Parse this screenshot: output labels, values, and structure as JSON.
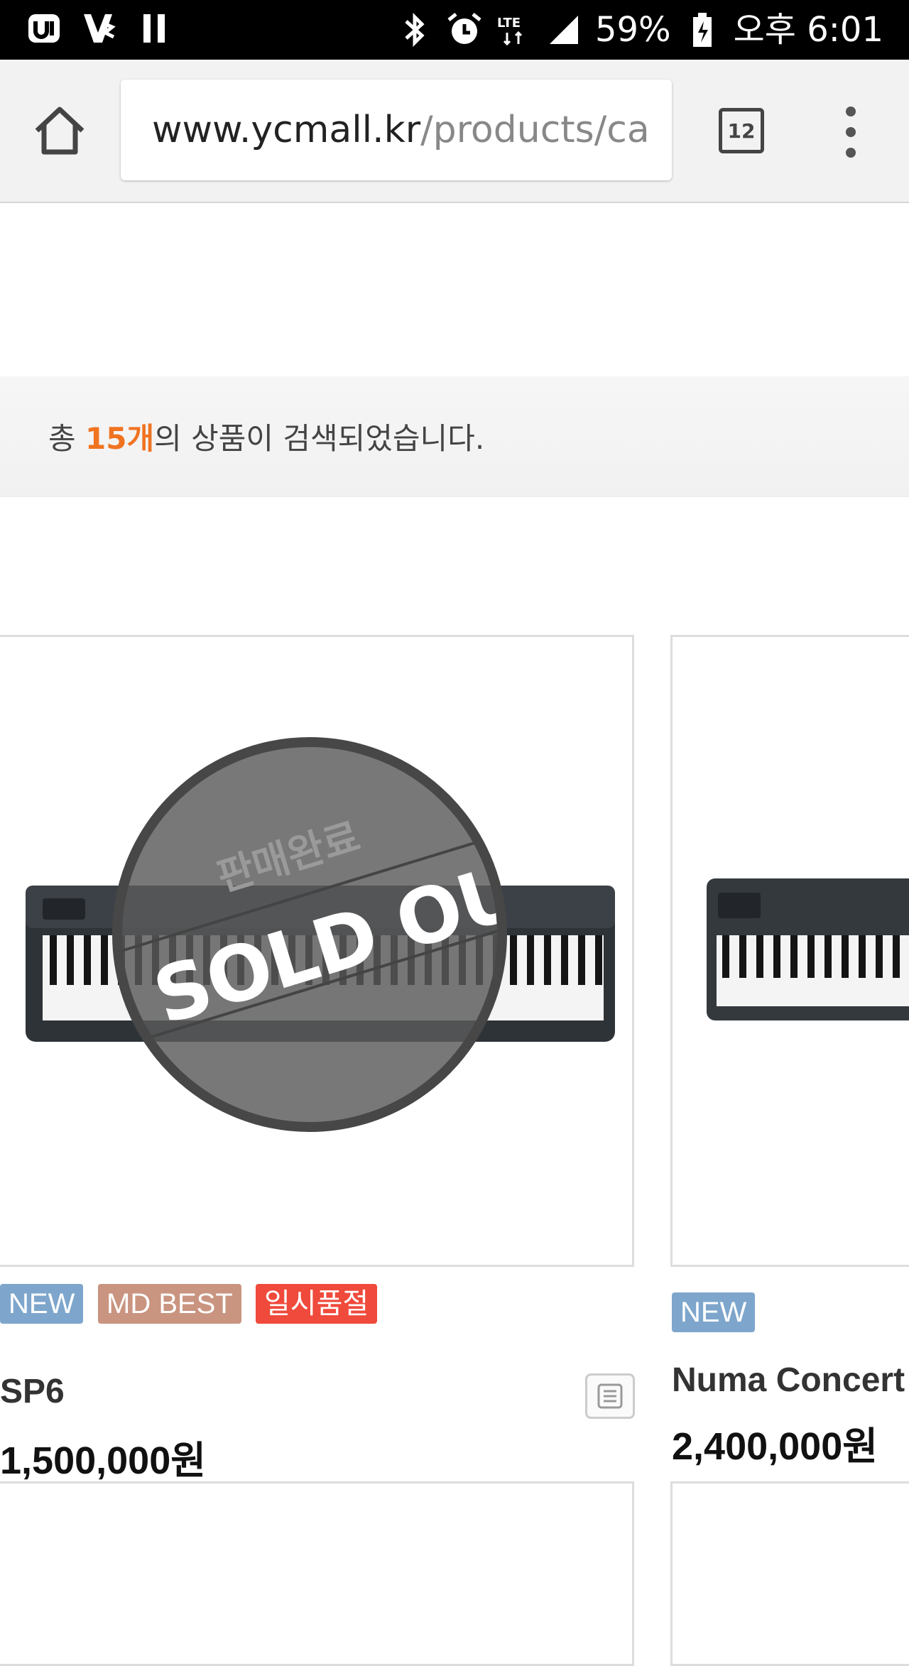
{
  "status_bar": {
    "battery": "59%",
    "time": "오후 6:01",
    "network": "LTE"
  },
  "browser": {
    "url_host": "www.ycmall.kr",
    "url_path": "/products/ca",
    "tab_count": "12"
  },
  "search_result": {
    "prefix": "총 ",
    "count": "15개",
    "suffix": "의 상품이 검색되었습니다."
  },
  "products": [
    {
      "name": "SP6",
      "price": "1,500,000원",
      "badges": [
        "NEW",
        "MD BEST",
        "일시품절"
      ],
      "sold_out": {
        "korean": "판매완료",
        "english": "SOLD OUT"
      }
    },
    {
      "name": "Numa Concert",
      "price": "2,400,000원",
      "badges": [
        "NEW"
      ]
    }
  ],
  "colors": {
    "accent": "#f07321",
    "badge_new": "#7ea6cc",
    "badge_md_best": "#c99480",
    "badge_soldout": "#ef4a3b"
  }
}
